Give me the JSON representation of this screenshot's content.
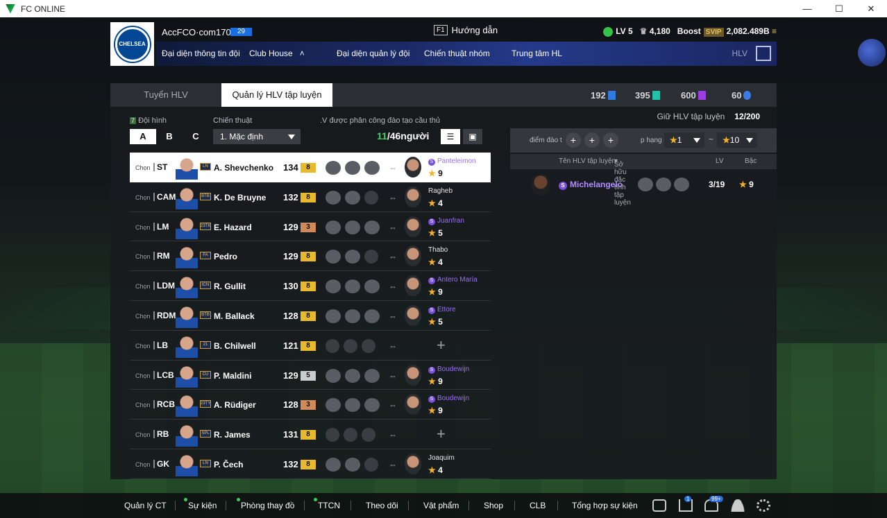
{
  "window": {
    "title": "FC ONLINE",
    "controls": {
      "minimize": "—",
      "maximize": "☐",
      "close": "✕"
    }
  },
  "header": {
    "account": "AccFCO·com1704b",
    "account_level": "29",
    "guide_key": "F1",
    "guide_label": "Hướng dẫn",
    "lv": "LV 5",
    "trophies": "4,180",
    "boost_label": "Boost",
    "svip_label": "SVIP",
    "coins": "2,082.489B",
    "club_logo_text": "CHELSEA"
  },
  "nav": {
    "items": [
      "Đại diện thông tin đội",
      "Club House",
      "Đại diện quản lý đội",
      "Chiến thuật nhóm",
      "Trung tâm HL"
    ],
    "club_house_arrow": "˄",
    "right_label": "HLV",
    "exit_icon": "exit-icon"
  },
  "tabs": {
    "coach": "Tuyển HLV",
    "training": "Quản lý HLV tập luyện"
  },
  "currencies": [
    {
      "value": "192",
      "color": "#2f7be0"
    },
    {
      "value": "395",
      "color": "#22c2a8"
    },
    {
      "value": "600",
      "color": "#9b3de0"
    },
    {
      "value": "60",
      "color": "#3a7be8"
    }
  ],
  "left": {
    "squad_label": "Đội hình",
    "squad_number": "7",
    "tactic_label": "Chiến thuật",
    "assigned_label": ".V được phân công đào tạo cầu thủ",
    "squads": [
      "A",
      "B",
      "C"
    ],
    "tactic_value": "1. Mặc định",
    "assigned_count": "11",
    "assigned_total": "/46người",
    "list_icon": "☰",
    "card_icon": "▣"
  },
  "players": [
    {
      "chon": "Chọn",
      "pos": "ST",
      "season": "LN",
      "name": "A. Shevchenko",
      "ovr": "134",
      "level": "8",
      "level_color": "#e8b92c",
      "skills": 3,
      "coach": "Panteleimon",
      "coach_premium": true,
      "stars": "9",
      "selected": true
    },
    {
      "chon": "Chọn",
      "pos": "CAM",
      "season": "BTB",
      "name": "K. De Bruyne",
      "ovr": "132",
      "level": "8",
      "level_color": "#e8b92c",
      "skills": 2,
      "coach": "Ragheb",
      "coach_premium": false,
      "stars": "4"
    },
    {
      "chon": "Chọn",
      "pos": "LM",
      "season": "23TK",
      "name": "E. Hazard",
      "ovr": "129",
      "level": "3",
      "level_color": "#d08a5a",
      "skills": 3,
      "coach": "Juanfran",
      "coach_premium": true,
      "stars": "5"
    },
    {
      "chon": "Chọn",
      "pos": "RM",
      "season": "FA",
      "name": "Pedro",
      "ovr": "129",
      "level": "8",
      "level_color": "#e8b92c",
      "skills": 2,
      "coach": "Thabo",
      "coach_premium": false,
      "stars": "4"
    },
    {
      "chon": "Chọn",
      "pos": "LDM",
      "season": "ICN",
      "name": "R. Gullit",
      "ovr": "130",
      "level": "8",
      "level_color": "#e8b92c",
      "skills": 3,
      "coach": "Antero María",
      "coach_premium": true,
      "stars": "9"
    },
    {
      "chon": "Chọn",
      "pos": "RDM",
      "season": "BTB",
      "name": "M. Ballack",
      "ovr": "128",
      "level": "8",
      "level_color": "#e8b92c",
      "skills": 3,
      "coach": "Ettore",
      "coach_premium": true,
      "stars": "5"
    },
    {
      "chon": "Chọn",
      "pos": "LB",
      "season": "21",
      "name": "B. Chilwell",
      "ovr": "121",
      "level": "8",
      "level_color": "#e8b92c",
      "skills": 0,
      "coach": "",
      "coach_premium": false,
      "stars": ""
    },
    {
      "chon": "Chọn",
      "pos": "LCB",
      "season": "CU",
      "name": "P. Maldini",
      "ovr": "129",
      "level": "5",
      "level_color": "#c9ccd1",
      "skills": 3,
      "coach": "Boudewijn",
      "coach_premium": true,
      "stars": "9"
    },
    {
      "chon": "Chọn",
      "pos": "RCB",
      "season": "23TY",
      "name": "A. Rüdiger",
      "ovr": "128",
      "level": "3",
      "level_color": "#d08a5a",
      "skills": 3,
      "coach": "Boudewijn",
      "coach_premium": true,
      "stars": "9"
    },
    {
      "chon": "Chọn",
      "pos": "RB",
      "season": "SPL",
      "name": "R. James",
      "ovr": "131",
      "level": "8",
      "level_color": "#e8b92c",
      "skills": 0,
      "coach": "",
      "coach_premium": false,
      "stars": ""
    },
    {
      "chon": "Chọn",
      "pos": "GK",
      "season": "LN",
      "name": "P. Čech",
      "ovr": "132",
      "level": "8",
      "level_color": "#e8b92c",
      "skills": 2,
      "coach": "Joaquim",
      "coach_premium": false,
      "stars": "4"
    }
  ],
  "right": {
    "slots_label": "Giữ HLV tập luyện",
    "slots_value": "12/200",
    "filter": {
      "training_points": "điểm đào t",
      "rank_label": "p hạng",
      "rank_from": "1",
      "rank_sep": "~",
      "rank_to": "10"
    },
    "columns": {
      "name": "Tên HLV tập luyện",
      "traits": "Sở hữu đặc tính tập luyện",
      "lv": "LV",
      "grade": "Bậc"
    },
    "coaches": [
      {
        "name": "Michelangelo",
        "lv": "3/19",
        "grade": "9"
      }
    ]
  },
  "bottom": {
    "items": [
      "Quản lý CT",
      "Sự kiện",
      "Phòng thay đồ",
      "TTCN",
      "Theo dõi",
      "Vật phẩm",
      "Shop",
      "CLB",
      "Tổng hợp sự kiện"
    ],
    "badge_home": "1",
    "badge_bell": "99+"
  },
  "star_glyph": "★",
  "plus_glyph": "+",
  "link_glyph": "⇔",
  "premium_glyph": "S"
}
